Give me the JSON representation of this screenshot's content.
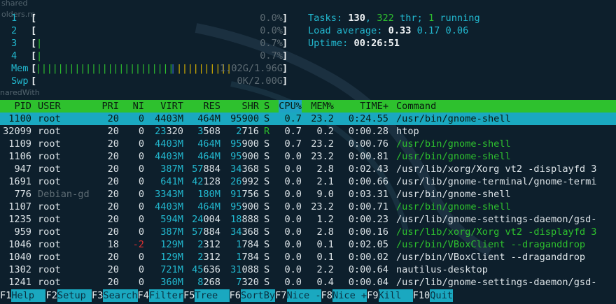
{
  "desktop": {
    "label_top": "shared",
    "label_top2": "olders.rn",
    "label_mid": "naredWith"
  },
  "meters": {
    "cpus": [
      {
        "id": "1",
        "bar": "",
        "value": "0.0%"
      },
      {
        "id": "2",
        "bar": "",
        "value": "0.0%"
      },
      {
        "id": "3",
        "bar": "|",
        "value": "0.7%"
      },
      {
        "id": "4",
        "bar": "|",
        "value": "0.7%"
      }
    ],
    "mem": {
      "label": "Mem",
      "bar_green": "|||||||||||||||||||||||||",
      "bar_blue": "|",
      "bar_yellow": "||||||||||",
      "value": "1.02G/1.96G"
    },
    "swp": {
      "label": "Swp",
      "value": "0K/2.00G"
    }
  },
  "summary": {
    "tasks_label": "Tasks:",
    "tasks": "130",
    "sep": ",",
    "threads": "322",
    "thr_label": "thr;",
    "running": "1",
    "running_label": "running",
    "load_label": "Load average:",
    "load1": "0.33",
    "load5": "0.17",
    "load15": "0.06",
    "uptime_label": "Uptime:",
    "uptime": "00:26:51"
  },
  "table": {
    "headers": {
      "pid": "PID",
      "user": "USER",
      "pri": "PRI",
      "ni": "NI",
      "virt": "VIRT",
      "res": "RES",
      "shr": "SHR",
      "s": "S",
      "cpu": "CPU%",
      "mem": "MEM%",
      "time": "TIME+",
      "cmd": "Command"
    },
    "rows": [
      {
        "pid": "1100",
        "user": "root",
        "pri": "20",
        "ni": "0",
        "virt": "4403M",
        "res": "464M",
        "shr": "95900",
        "s": "S",
        "cpu": "0.7",
        "mem": "23.2",
        "time": "0:24.55",
        "cmd": "/usr/bin/gnome-shell"
      },
      {
        "pid": "32099",
        "user": "root",
        "pri": "20",
        "ni": "0",
        "virt": "23320",
        "res": "3508",
        "shr": "2716",
        "s": "R",
        "cpu": "0.7",
        "mem": "0.2",
        "time": "0:00.28",
        "cmd": "htop"
      },
      {
        "pid": "1109",
        "user": "root",
        "pri": "20",
        "ni": "0",
        "virt": "4403M",
        "res": "464M",
        "shr": "95900",
        "s": "S",
        "cpu": "0.7",
        "mem": "23.2",
        "time": "0:00.76",
        "cmd": "/usr/bin/gnome-shell"
      },
      {
        "pid": "1106",
        "user": "root",
        "pri": "20",
        "ni": "0",
        "virt": "4403M",
        "res": "464M",
        "shr": "95900",
        "s": "S",
        "cpu": "0.0",
        "mem": "23.2",
        "time": "0:00.81",
        "cmd": "/usr/bin/gnome-shell"
      },
      {
        "pid": "947",
        "user": "root",
        "pri": "20",
        "ni": "0",
        "virt": "387M",
        "res": "57884",
        "shr": "34368",
        "s": "S",
        "cpu": "0.0",
        "mem": "2.8",
        "time": "0:02.43",
        "cmd": "/usr/lib/xorg/Xorg vt2 -displayfd 3"
      },
      {
        "pid": "1691",
        "user": "root",
        "pri": "20",
        "ni": "0",
        "virt": "641M",
        "res": "42128",
        "shr": "26992",
        "s": "S",
        "cpu": "0.0",
        "mem": "2.1",
        "time": "0:00.66",
        "cmd": "/usr/lib/gnome-terminal/gnome-termi"
      },
      {
        "pid": "776",
        "user": "Debian-gd",
        "pri": "20",
        "ni": "0",
        "virt": "3343M",
        "res": "180M",
        "shr": "91756",
        "s": "S",
        "cpu": "0.0",
        "mem": "9.0",
        "time": "0:03.31",
        "cmd": "/usr/bin/gnome-shell"
      },
      {
        "pid": "1107",
        "user": "root",
        "pri": "20",
        "ni": "0",
        "virt": "4403M",
        "res": "464M",
        "shr": "95900",
        "s": "S",
        "cpu": "0.0",
        "mem": "23.2",
        "time": "0:00.71",
        "cmd": "/usr/bin/gnome-shell"
      },
      {
        "pid": "1235",
        "user": "root",
        "pri": "20",
        "ni": "0",
        "virt": "594M",
        "res": "24004",
        "shr": "18888",
        "s": "S",
        "cpu": "0.0",
        "mem": "1.2",
        "time": "0:00.23",
        "cmd": "/usr/lib/gnome-settings-daemon/gsd-"
      },
      {
        "pid": "959",
        "user": "root",
        "pri": "20",
        "ni": "0",
        "virt": "387M",
        "res": "57884",
        "shr": "34368",
        "s": "S",
        "cpu": "0.0",
        "mem": "2.8",
        "time": "0:00.16",
        "cmd": "/usr/lib/xorg/Xorg vt2 -displayfd 3"
      },
      {
        "pid": "1046",
        "user": "root",
        "pri": "18",
        "ni": "-2",
        "virt": "129M",
        "res": "2312",
        "shr": "1784",
        "s": "S",
        "cpu": "0.0",
        "mem": "0.1",
        "time": "0:02.05",
        "cmd": "/usr/bin/VBoxClient --draganddrop"
      },
      {
        "pid": "1040",
        "user": "root",
        "pri": "20",
        "ni": "0",
        "virt": "129M",
        "res": "2312",
        "shr": "1784",
        "s": "S",
        "cpu": "0.0",
        "mem": "0.1",
        "time": "0:00.02",
        "cmd": "/usr/bin/VBoxClient --draganddrop"
      },
      {
        "pid": "1302",
        "user": "root",
        "pri": "20",
        "ni": "0",
        "virt": "721M",
        "res": "45636",
        "shr": "31088",
        "s": "S",
        "cpu": "0.0",
        "mem": "2.2",
        "time": "0:00.64",
        "cmd": "nautilus-desktop"
      },
      {
        "pid": "1241",
        "user": "root",
        "pri": "20",
        "ni": "0",
        "virt": "360M",
        "res": "8268",
        "shr": "7320",
        "s": "S",
        "cpu": "0.0",
        "mem": "0.4",
        "time": "0:00.04",
        "cmd": "/usr/lib/gnome-settings-daemon/gsd-"
      }
    ]
  },
  "footer": [
    {
      "key": "F1",
      "label": "Help  "
    },
    {
      "key": "F2",
      "label": "Setup "
    },
    {
      "key": "F3",
      "label": "Search"
    },
    {
      "key": "F4",
      "label": "Filter"
    },
    {
      "key": "F5",
      "label": "Tree  "
    },
    {
      "key": "F6",
      "label": "SortBy"
    },
    {
      "key": "F7",
      "label": "Nice -"
    },
    {
      "key": "F8",
      "label": "Nice +"
    },
    {
      "key": "F9",
      "label": "Kill  "
    },
    {
      "key": "F10",
      "label": "Quit"
    }
  ],
  "colors": {
    "header_bg": "#2ec12e",
    "selected_bg": "#1aa8c0",
    "cyan": "#22b8cf",
    "green": "#2ec12e"
  }
}
